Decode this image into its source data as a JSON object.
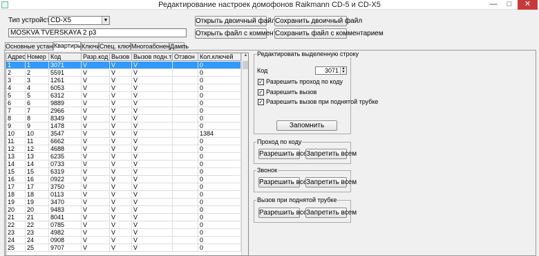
{
  "window": {
    "title": "Редактирование настроек домофонов Raikmann CD-5 и CD-X5",
    "minimize": "—",
    "maximize": "□",
    "close": "✕"
  },
  "device": {
    "type_label": "Тип устройства",
    "type_value": "CD-X5",
    "address_value": "MOSKVA TVERSKAYA 2 p3"
  },
  "toolbar": {
    "open_binary": "Открыть двоичный файл",
    "save_binary": "Сохранить двоичный файл",
    "open_commented": "Открыть файл с комментарием",
    "save_commented": "Сохранить файл с комментарием"
  },
  "tabs": [
    {
      "label": "Основные установки"
    },
    {
      "label": "Квартиры"
    },
    {
      "label": "Ключи"
    },
    {
      "label": "Спец. ключи"
    },
    {
      "label": "Многоабонентность"
    },
    {
      "label": "Дамп"
    }
  ],
  "flats_table": {
    "columns": [
      "Адрес",
      "Номер",
      "Код",
      "Разр.код",
      "Вызов",
      "Вызов подн.тр.",
      "Отзвон",
      "Кол.ключей"
    ],
    "rows": [
      {
        "address": "1",
        "number": "1",
        "code": "3071",
        "code_allowed": "V",
        "call": "V",
        "handset_call": "V",
        "callback": "",
        "keys": "0"
      },
      {
        "address": "2",
        "number": "2",
        "code": "5591",
        "code_allowed": "V",
        "call": "V",
        "handset_call": "V",
        "callback": "",
        "keys": "0"
      },
      {
        "address": "3",
        "number": "3",
        "code": "1261",
        "code_allowed": "V",
        "call": "V",
        "handset_call": "V",
        "callback": "",
        "keys": "0"
      },
      {
        "address": "4",
        "number": "4",
        "code": "6053",
        "code_allowed": "V",
        "call": "V",
        "handset_call": "V",
        "callback": "",
        "keys": "0"
      },
      {
        "address": "5",
        "number": "5",
        "code": "6312",
        "code_allowed": "V",
        "call": "V",
        "handset_call": "V",
        "callback": "",
        "keys": "0"
      },
      {
        "address": "6",
        "number": "6",
        "code": "9889",
        "code_allowed": "V",
        "call": "V",
        "handset_call": "V",
        "callback": "",
        "keys": "0"
      },
      {
        "address": "7",
        "number": "7",
        "code": "2966",
        "code_allowed": "V",
        "call": "V",
        "handset_call": "V",
        "callback": "",
        "keys": "0"
      },
      {
        "address": "8",
        "number": "8",
        "code": "8349",
        "code_allowed": "V",
        "call": "V",
        "handset_call": "V",
        "callback": "",
        "keys": "0"
      },
      {
        "address": "9",
        "number": "9",
        "code": "1478",
        "code_allowed": "V",
        "call": "V",
        "handset_call": "V",
        "callback": "",
        "keys": "0"
      },
      {
        "address": "10",
        "number": "10",
        "code": "3547",
        "code_allowed": "V",
        "call": "V",
        "handset_call": "V",
        "callback": "",
        "keys": "1384"
      },
      {
        "address": "11",
        "number": "11",
        "code": "6662",
        "code_allowed": "V",
        "call": "V",
        "handset_call": "V",
        "callback": "",
        "keys": "0"
      },
      {
        "address": "12",
        "number": "12",
        "code": "4688",
        "code_allowed": "V",
        "call": "V",
        "handset_call": "V",
        "callback": "",
        "keys": "0"
      },
      {
        "address": "13",
        "number": "13",
        "code": "6235",
        "code_allowed": "V",
        "call": "V",
        "handset_call": "V",
        "callback": "",
        "keys": "0"
      },
      {
        "address": "14",
        "number": "14",
        "code": "0733",
        "code_allowed": "V",
        "call": "V",
        "handset_call": "V",
        "callback": "",
        "keys": "0"
      },
      {
        "address": "15",
        "number": "15",
        "code": "6319",
        "code_allowed": "V",
        "call": "V",
        "handset_call": "V",
        "callback": "",
        "keys": "0"
      },
      {
        "address": "16",
        "number": "16",
        "code": "0922",
        "code_allowed": "V",
        "call": "V",
        "handset_call": "V",
        "callback": "",
        "keys": "0"
      },
      {
        "address": "17",
        "number": "17",
        "code": "3750",
        "code_allowed": "V",
        "call": "V",
        "handset_call": "V",
        "callback": "",
        "keys": "0"
      },
      {
        "address": "18",
        "number": "18",
        "code": "0113",
        "code_allowed": "V",
        "call": "V",
        "handset_call": "V",
        "callback": "",
        "keys": "0"
      },
      {
        "address": "19",
        "number": "19",
        "code": "3470",
        "code_allowed": "V",
        "call": "V",
        "handset_call": "V",
        "callback": "",
        "keys": "0"
      },
      {
        "address": "20",
        "number": "20",
        "code": "9483",
        "code_allowed": "V",
        "call": "V",
        "handset_call": "V",
        "callback": "",
        "keys": "0"
      },
      {
        "address": "21",
        "number": "21",
        "code": "8041",
        "code_allowed": "V",
        "call": "V",
        "handset_call": "V",
        "callback": "",
        "keys": "0"
      },
      {
        "address": "22",
        "number": "22",
        "code": "0785",
        "code_allowed": "V",
        "call": "V",
        "handset_call": "V",
        "callback": "",
        "keys": "0"
      },
      {
        "address": "23",
        "number": "23",
        "code": "4982",
        "code_allowed": "V",
        "call": "V",
        "handset_call": "V",
        "callback": "",
        "keys": "0"
      },
      {
        "address": "24",
        "number": "24",
        "code": "0908",
        "code_allowed": "V",
        "call": "V",
        "handset_call": "V",
        "callback": "",
        "keys": "0"
      },
      {
        "address": "25",
        "number": "25",
        "code": "9707",
        "code_allowed": "V",
        "call": "V",
        "handset_call": "V",
        "callback": "",
        "keys": "0"
      }
    ]
  },
  "edit_panel": {
    "title": "Редактировать выделенную строку",
    "code_label": "Код",
    "code_value": "3071",
    "allow_code": "Разрешить проход по коду",
    "allow_call": "Разрешить вызов",
    "allow_handset_call": "Разрешить вызов при поднятой трубке",
    "remember": "Запомнить"
  },
  "group_code": {
    "title": "Проход по коду",
    "allow_all": "Разрешить всем",
    "deny_all": "Запретить всем"
  },
  "group_ring": {
    "title": "Звонок",
    "allow_all": "Разрешить всем",
    "deny_all": "Запретить всем"
  },
  "group_handset": {
    "title": "Вызов при поднятой трубке",
    "allow_all": "Разрешить всем",
    "deny_all": "Запретить всем"
  },
  "selected_row": 0,
  "colors": {
    "selection": "#3399ff",
    "close_button": "#c73a3a"
  }
}
